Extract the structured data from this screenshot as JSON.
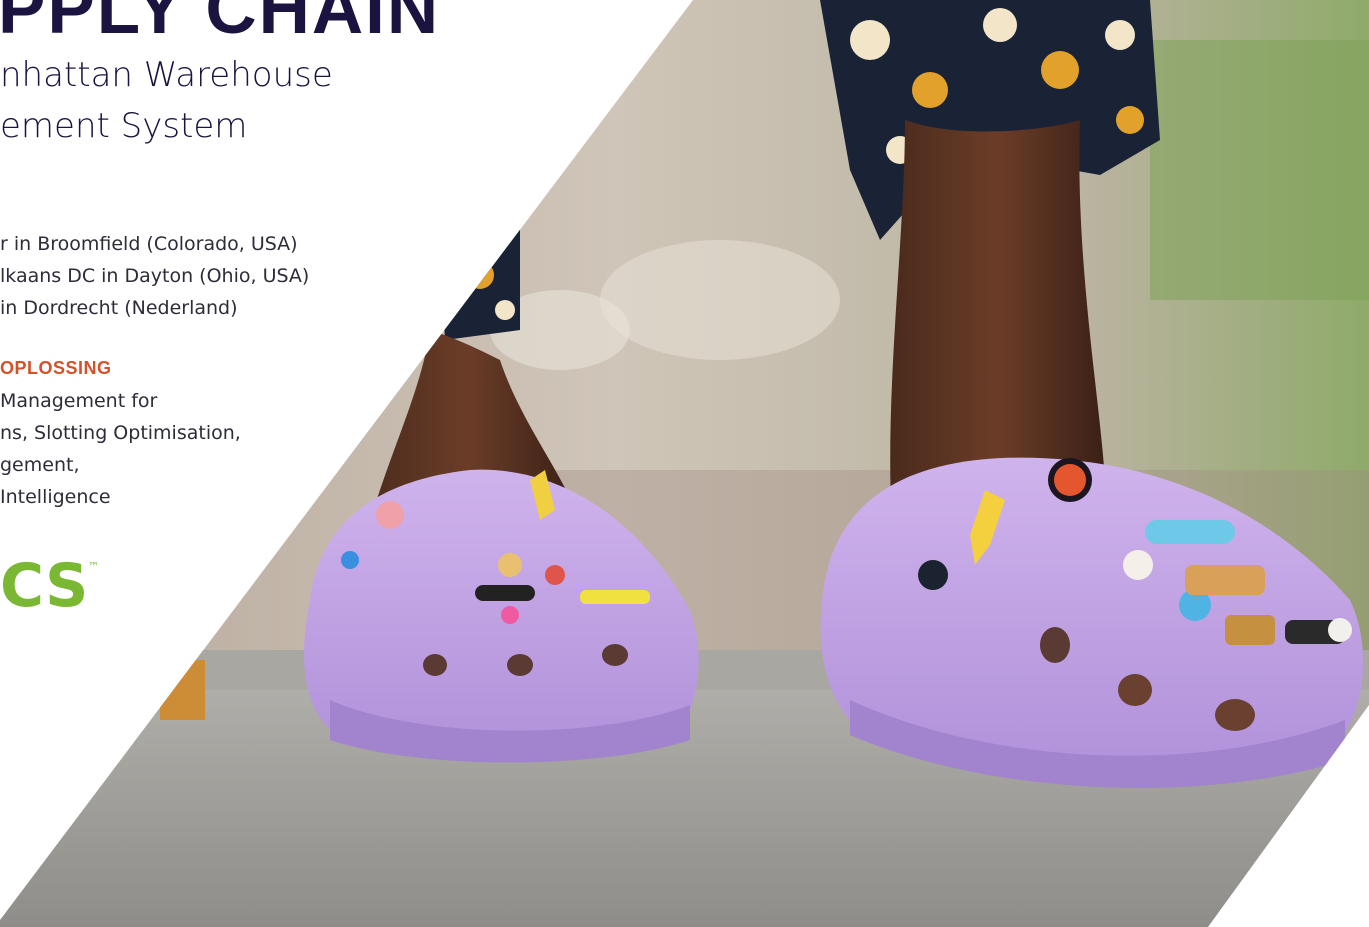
{
  "header": {
    "title": "PPLY CHAIN",
    "subtitle_lines": [
      "nhattan Warehouse",
      "ement System"
    ]
  },
  "locations": [
    "r in Broomfield (Colorado, USA)",
    "lkaans DC in Dayton (Ohio, USA)",
    "in Dordrecht (Nederland)"
  ],
  "solution": {
    "heading": "OPLOSSING",
    "lines": [
      "Management for",
      "ns, Slotting Optimisation,",
      "gement,",
      "Intelligence"
    ]
  },
  "logo": {
    "text": "CS",
    "trademark": "™",
    "color": "#7ab733"
  },
  "colors": {
    "title": "#1b1340",
    "accent": "#d2522a",
    "body": "#2d2d3a",
    "shoe": "#c5a6e6"
  }
}
